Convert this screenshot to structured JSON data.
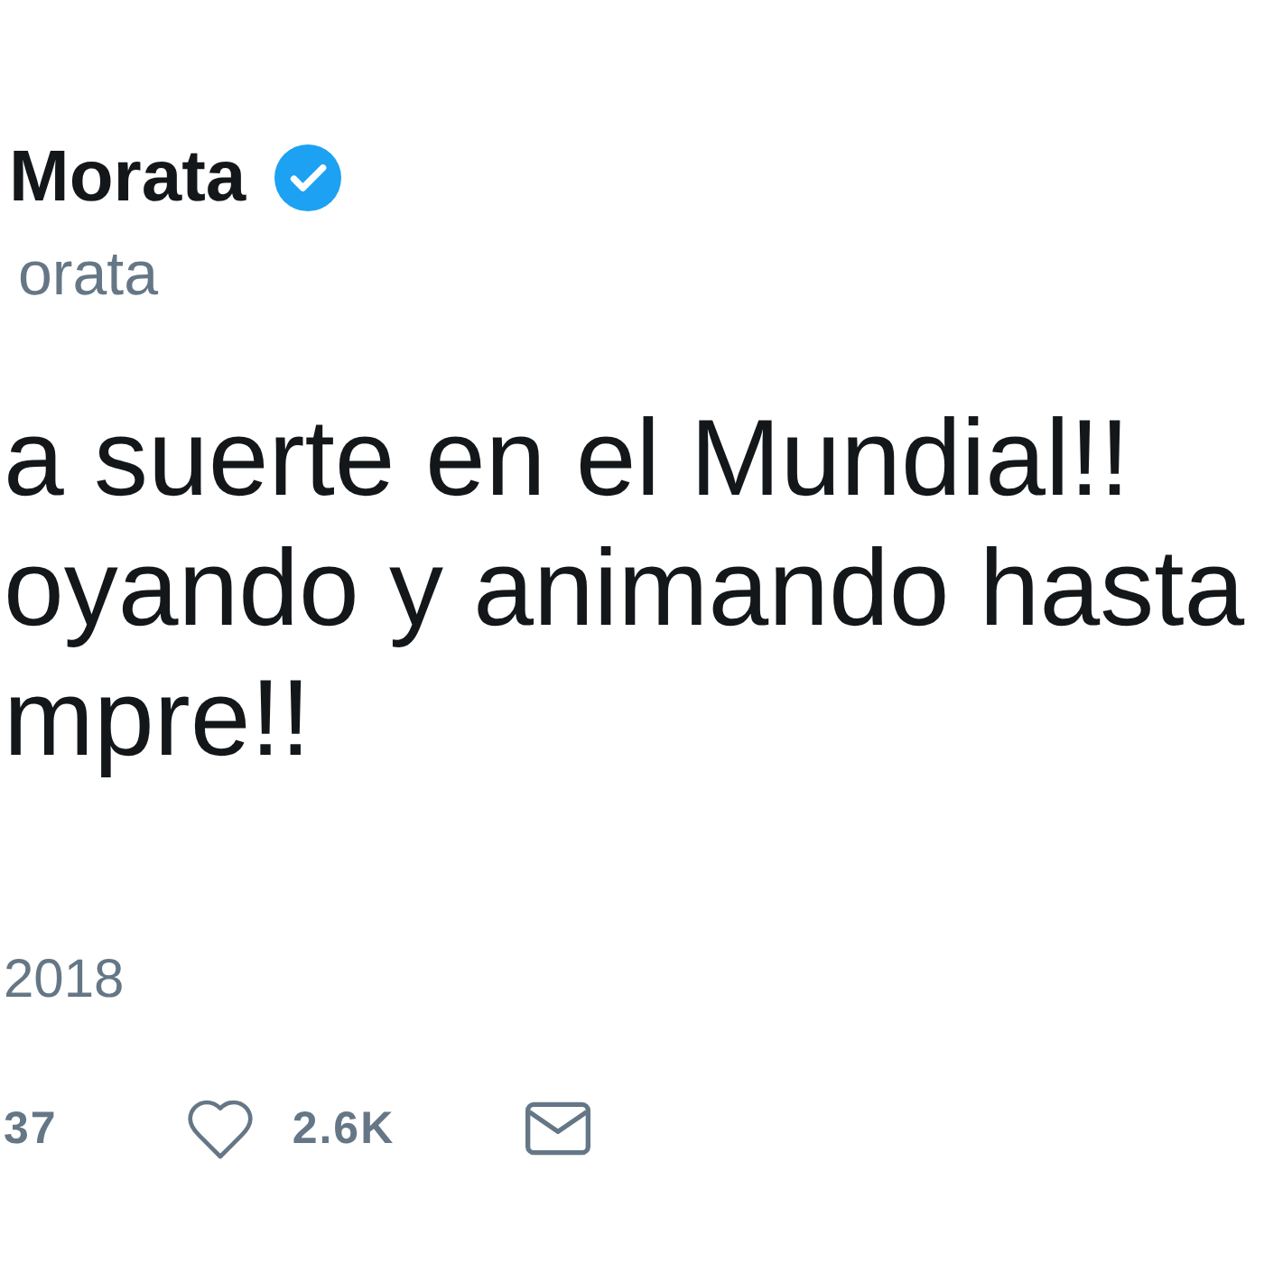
{
  "tweet": {
    "author": {
      "name": "Morata",
      "verified": true,
      "handle": "orata"
    },
    "text_lines": [
      "a suerte en el Mundial!!",
      "oyando y animando hasta",
      "mpre!!"
    ],
    "date": "2018",
    "actions": [
      {
        "kind": "plain",
        "count": "37"
      },
      {
        "kind": "like",
        "count": "2.6K"
      },
      {
        "kind": "message"
      }
    ]
  }
}
